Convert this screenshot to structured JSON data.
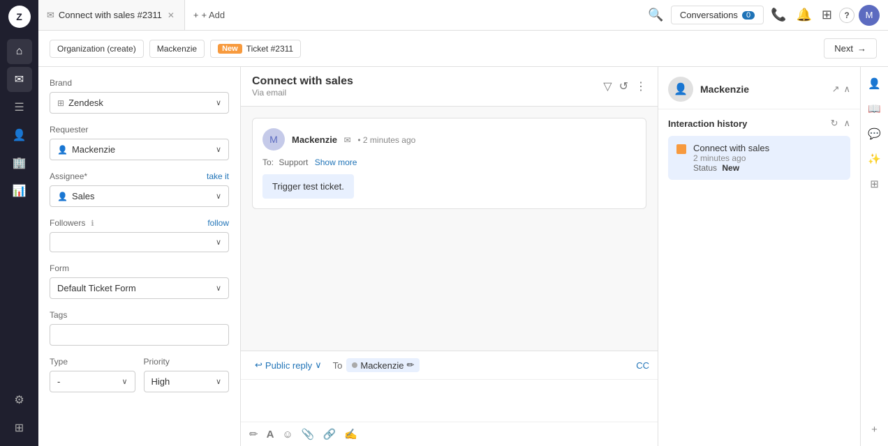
{
  "sidebar": {
    "logo": "Z",
    "nav_items": [
      {
        "id": "home",
        "icon": "⌂",
        "label": "Home"
      },
      {
        "id": "tickets",
        "icon": "✉",
        "label": "Tickets",
        "active": true
      },
      {
        "id": "views",
        "icon": "☰",
        "label": "Views"
      },
      {
        "id": "customers",
        "icon": "👤",
        "label": "Customers"
      },
      {
        "id": "organizations",
        "icon": "🏢",
        "label": "Organizations"
      },
      {
        "id": "reports",
        "icon": "📊",
        "label": "Reports"
      },
      {
        "id": "settings",
        "icon": "⚙",
        "label": "Settings"
      },
      {
        "id": "extensions",
        "icon": "⊞",
        "label": "Extensions"
      }
    ]
  },
  "tabs": {
    "current": {
      "title": "Connect with sales",
      "id": "#2311",
      "label": "Connect with sales #2311"
    },
    "add_label": "+ Add"
  },
  "breadcrumbs": [
    {
      "label": "Organization (create)",
      "type": "text"
    },
    {
      "label": "Mackenzie",
      "type": "text"
    },
    {
      "label": "New",
      "type": "badge",
      "badge_color": "#f79a3e"
    },
    {
      "label": "Ticket #2311",
      "type": "text"
    }
  ],
  "next_button": "Next",
  "left_panel": {
    "brand": {
      "label": "Brand",
      "value": "Zendesk"
    },
    "requester": {
      "label": "Requester",
      "value": "Mackenzie"
    },
    "assignee": {
      "label": "Assignee*",
      "value": "Sales",
      "take_link": "take it"
    },
    "followers": {
      "label": "Followers",
      "follow_link": "follow"
    },
    "form": {
      "label": "Form",
      "value": "Default Ticket Form"
    },
    "tags": {
      "label": "Tags"
    },
    "type": {
      "label": "Type",
      "value": "-"
    },
    "priority": {
      "label": "Priority",
      "value": "High"
    }
  },
  "ticket": {
    "title": "Connect with sales",
    "via": "Via email",
    "sender": "Mackenzie",
    "time": "2 minutes ago",
    "to_label": "To:",
    "to_address": "Support",
    "show_more": "Show more",
    "body": "Trigger test ticket."
  },
  "reply": {
    "type": "Public reply",
    "to_label": "To",
    "recipient": "Mackenzie",
    "cc_label": "CC"
  },
  "customer": {
    "name": "Mackenzie"
  },
  "interaction_history": {
    "title": "Interaction history",
    "item": {
      "title": "Connect with sales",
      "time": "2 minutes ago",
      "status_label": "Status",
      "status_value": "New"
    }
  },
  "global_nav": {
    "conversations_label": "Conversations",
    "conversations_count": "0",
    "search_placeholder": "Search"
  },
  "icons": {
    "search": "🔍",
    "phone": "📞",
    "bell": "🔔",
    "grid": "⊞",
    "help": "?",
    "filter": "▽",
    "history": "↺",
    "more": "⋮",
    "expand": "↗",
    "collapse": "∧",
    "refresh": "↻",
    "chevron_down": "∨",
    "edit": "✏",
    "close": "✕",
    "arrow_right": "→",
    "bold": "B",
    "italic": "I",
    "emoji": "☺",
    "attach": "📎",
    "link": "🔗",
    "signature": "✍",
    "plus": "+",
    "reply": "↩",
    "chat": "💬",
    "star": "★",
    "user": "👤",
    "book": "📖",
    "magic": "✨",
    "apps": "⊞"
  }
}
